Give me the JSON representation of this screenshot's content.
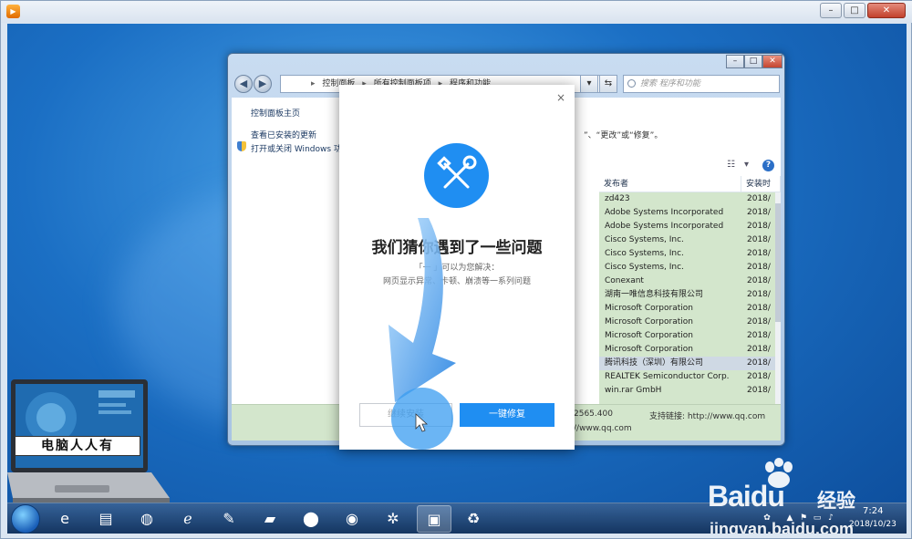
{
  "player": {
    "icon": "player-app-icon",
    "controls": [
      "minimize-icon",
      "maximize-icon",
      "close-icon"
    ]
  },
  "explorer": {
    "breadcrumb": [
      "控制面板",
      "所有控制面板项",
      "程序和功能"
    ],
    "search_placeholder": "搜索 程序和功能",
    "left_links": [
      "控制面板主页",
      "查看已安装的更新",
      "打开或关闭 Windows 功"
    ],
    "description": "”、“更改”或“修复”。",
    "columns": [
      "发布者",
      "安装时"
    ],
    "rows": [
      {
        "publisher": "zd423",
        "date": "2018/"
      },
      {
        "publisher": "Adobe Systems Incorporated",
        "date": "2018/"
      },
      {
        "publisher": "Adobe Systems Incorporated",
        "date": "2018/"
      },
      {
        "publisher": "Cisco Systems, Inc.",
        "date": "2018/"
      },
      {
        "publisher": "Cisco Systems, Inc.",
        "date": "2018/"
      },
      {
        "publisher": "Cisco Systems, Inc.",
        "date": "2018/"
      },
      {
        "publisher": "Conexant",
        "date": "2018/"
      },
      {
        "publisher": "湖南一唯信息科技有限公司",
        "date": "2018/"
      },
      {
        "publisher": "Microsoft Corporation",
        "date": "2018/"
      },
      {
        "publisher": "Microsoft Corporation",
        "date": "2018/"
      },
      {
        "publisher": "Microsoft Corporation",
        "date": "2018/"
      },
      {
        "publisher": "Microsoft Corporation",
        "date": "2018/"
      },
      {
        "publisher": "腾讯科技（深圳）有限公司",
        "date": "2018/"
      },
      {
        "publisher": "REALTEK Semiconductor Corp.",
        "date": "2018/"
      },
      {
        "publisher": "win.rar GmbH",
        "date": "2018/"
      }
    ],
    "selected_row": 12,
    "detail": {
      "version_frag": "2565.400",
      "support_label": "支持链接: http://www.qq.com",
      "url_frag": "//www.qq.com"
    }
  },
  "dialog": {
    "close": "×",
    "icon": "wrench-screwdriver-icon",
    "title": "我们猜你遇到了一些问题",
    "line1": "「一        」可以为您解决：",
    "line2": "网页显示异常、卡顿、崩溃等一系列问题",
    "continue_label": "继续安装",
    "fix_label": "一键修复"
  },
  "overlay": {
    "icon": "blue-arrow-pointer"
  },
  "logo": {
    "caption": "电脑人人有"
  },
  "taskbar": {
    "apps": [
      "ie-icon",
      "folder-icon",
      "network-icon",
      "ie-icon",
      "paint-icon",
      "folder-icon",
      "chess-icon",
      "media-icon",
      "pinwheel-icon",
      "control-panel-icon",
      "recycle-bin-icon"
    ],
    "time": "7:24",
    "date": "2018/10/23"
  },
  "watermark": {
    "logo": "Bai",
    "logo2": "du",
    "exp": "经验",
    "url": "jingyan.baidu.com"
  }
}
